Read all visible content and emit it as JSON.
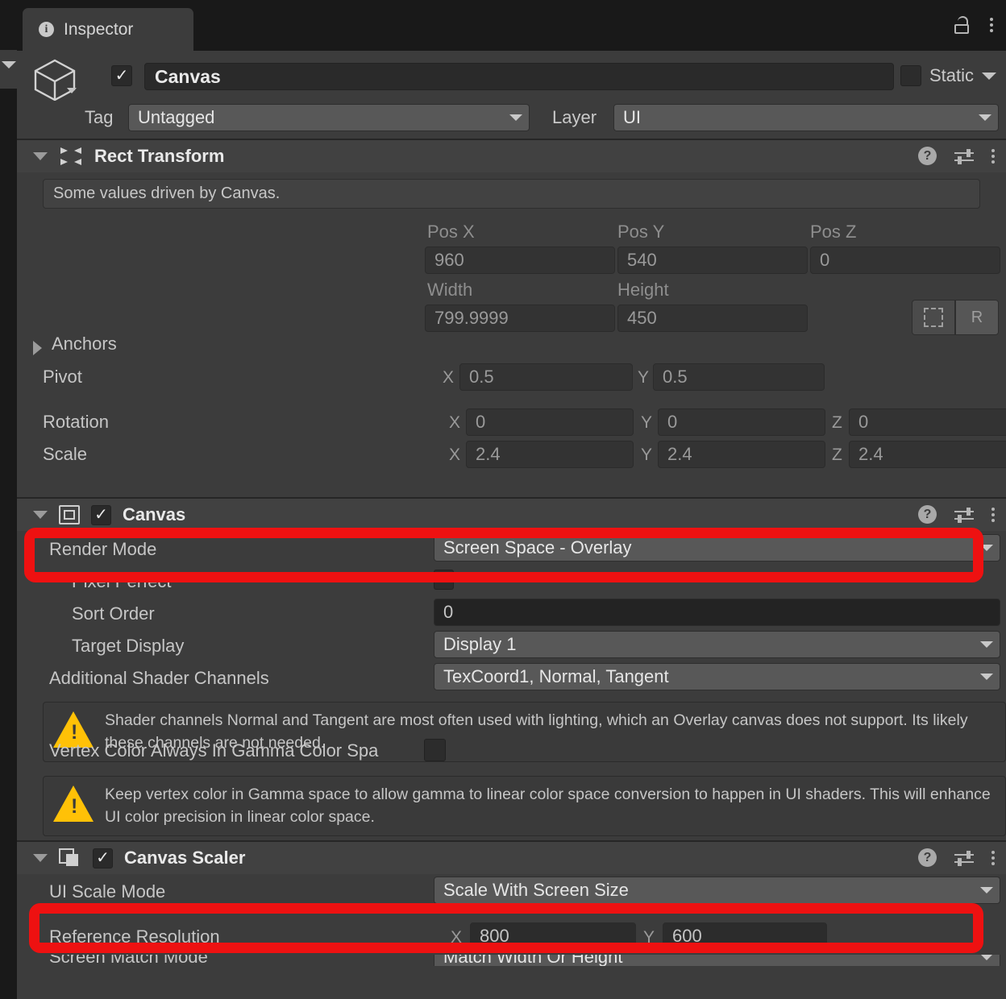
{
  "window": {
    "tab_title": "Inspector",
    "info_icon": "info-icon",
    "lock_icon": "lock-icon",
    "menu_icon": "kebab-menu-icon"
  },
  "object_header": {
    "enabled_checkmark": "✓",
    "object_name": "Canvas",
    "static_label": "Static",
    "tag_label": "Tag",
    "tag_value": "Untagged",
    "layer_label": "Layer",
    "layer_value": "UI"
  },
  "rect_transform": {
    "title": "Rect Transform",
    "help_text": "Some values driven by Canvas.",
    "pos_x_label": "Pos X",
    "pos_y_label": "Pos Y",
    "pos_z_label": "Pos Z",
    "pos_x": "960",
    "pos_y": "540",
    "pos_z": "0",
    "width_label": "Width",
    "height_label": "Height",
    "width": "799.9999",
    "height": "450",
    "anchor_preset_icon": "anchor-preset-icon",
    "blueprint_label": "R",
    "anchors_label": "Anchors",
    "pivot_label": "Pivot",
    "pivot_x_axis": "X",
    "pivot_x": "0.5",
    "pivot_y_axis": "Y",
    "pivot_y": "0.5",
    "rotation_label": "Rotation",
    "rotation_x_axis": "X",
    "rotation_x": "0",
    "rotation_y_axis": "Y",
    "rotation_y": "0",
    "rotation_z_axis": "Z",
    "rotation_z": "0",
    "scale_label": "Scale",
    "scale_x_axis": "X",
    "scale_x": "2.4",
    "scale_y_axis": "Y",
    "scale_y": "2.4",
    "scale_z_axis": "Z",
    "scale_z": "2.4"
  },
  "canvas": {
    "title": "Canvas",
    "enabled_checkmark": "✓",
    "render_mode_label": "Render Mode",
    "render_mode_value": "Screen Space - Overlay",
    "pixel_perfect_label": "Pixel Perfect",
    "sort_order_label": "Sort Order",
    "sort_order_value": "0",
    "target_display_label": "Target Display",
    "target_display_value": "Display 1",
    "shader_channels_label": "Additional Shader Channels",
    "shader_channels_value": "TexCoord1, Normal, Tangent",
    "warning_1": "Shader channels Normal and Tangent are most often used with lighting, which an Overlay canvas does not support. Its likely these channels are not needed.",
    "vertex_color_label": "Vertex Color Always In Gamma Color Spa",
    "warning_2": "Keep vertex color in Gamma space to allow gamma to linear color space conversion to happen in UI shaders. This will enhance UI color precision in linear color space."
  },
  "canvas_scaler": {
    "title": "Canvas Scaler",
    "enabled_checkmark": "✓",
    "ui_scale_mode_label": "UI Scale Mode",
    "ui_scale_mode_value": "Scale With Screen Size",
    "reference_resolution_label": "Reference Resolution",
    "ref_x_axis": "X",
    "ref_x": "800",
    "ref_y_axis": "Y",
    "ref_y": "600",
    "screen_match_mode_label": "Screen Match Mode",
    "screen_match_mode_value": "Match Width Or Height"
  },
  "header_action_icons": {
    "help": "?",
    "preset": "preset-icon",
    "menu": "kebab-menu-icon"
  },
  "colors": {
    "highlight": "#ee1111",
    "panel_bg": "#3c3c3c",
    "tabbar_bg": "#191919",
    "warning_yellow": "#ffc107"
  }
}
